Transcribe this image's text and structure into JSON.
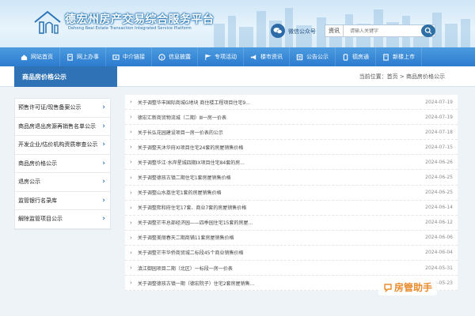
{
  "header": {
    "site_title": "德宏州房产交易综合服务平台",
    "site_subtitle": "Dehong Real Estate Transaction Integrated Service Platform",
    "wechat_label": "微信公众号",
    "search_scope": "资讯",
    "search_placeholder": "请输入关键字"
  },
  "nav": {
    "items": [
      {
        "label": "网站首页",
        "icon": "home-icon"
      },
      {
        "label": "网上办事",
        "icon": "document-icon"
      },
      {
        "label": "中介链接",
        "icon": "link-icon"
      },
      {
        "label": "信息披露",
        "icon": "info-icon"
      },
      {
        "label": "专项活动",
        "icon": "flag-icon"
      },
      {
        "label": "楼市资讯",
        "icon": "megaphone-icon"
      },
      {
        "label": "公告公示",
        "icon": "notice-icon"
      },
      {
        "label": "德房通",
        "icon": "app-icon"
      },
      {
        "label": "新楼上市",
        "icon": "building-icon"
      }
    ]
  },
  "section": {
    "title": "商品房价格公示",
    "breadcrumb_prefix": "当前位置：",
    "breadcrumb_home": "首页",
    "breadcrumb_sep": " > ",
    "breadcrumb_current": "商品房价格公示"
  },
  "sidebar": {
    "items": [
      {
        "label": "预售许可证/现售备案公示"
      },
      {
        "label": "商品房退出房源再销售名单公示"
      },
      {
        "label": "开发企业/估价机构资质审查公示"
      },
      {
        "label": "商品房价格公示"
      },
      {
        "label": "退房公示"
      },
      {
        "label": "监管银行名录库"
      },
      {
        "label": "解除监管项目公示"
      }
    ]
  },
  "list": {
    "rows": [
      {
        "title": "关于调整华丰国际商城G地块 商住楼工程项目住宅9...",
        "date": "2024-07-19"
      },
      {
        "title": "德宏汇新商贸物流城（二期）Ⅲ一房一价表",
        "date": "2024-07-19"
      },
      {
        "title": "关于长弘花园建设项目一房一价表的公示",
        "date": "2024-07-18"
      },
      {
        "title": "关于调整天沐华府XI项目住宅24套的房屋销售价格",
        "date": "2024-07-15"
      },
      {
        "title": "关于调整华江·水岸星城四期IX项目住宅84套的房...",
        "date": "2024-06-26"
      },
      {
        "title": "关于调整德孩古镇二期住宅1套房屋销售价格",
        "date": "2024-06-25"
      },
      {
        "title": "关于调整山水荔住宅1套的房屋销售价格",
        "date": "2024-06-25"
      },
      {
        "title": "关于调整熙和府住宅17套、商业7套的房屋销售价格",
        "date": "2024-06-14"
      },
      {
        "title": "关于调整芒市总部经济园——四季园住宅15套的房屋...",
        "date": "2024-06-12"
      },
      {
        "title": "关于调整美丽春天二期商铺11套房屋销售价格",
        "date": "2024-06-06"
      },
      {
        "title": "关于调整芒市华侨商贸城二标段45个商业销售价格",
        "date": "2024-06-04"
      },
      {
        "title": "滇江御园项目二期（北区）一标段一房一价表",
        "date": "2024-05-31"
      },
      {
        "title": "关于调整德孩古镇一期（德宏院子）住宅2套房屋销售...",
        "date": "2024-05-23"
      }
    ]
  },
  "assistant": {
    "label": "房管助手"
  }
}
